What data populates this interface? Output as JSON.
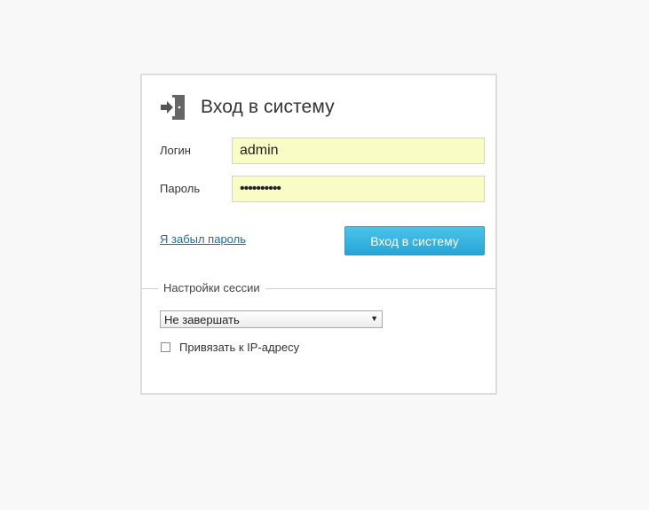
{
  "login": {
    "title": "Вход в систему",
    "icon": "sign-in-icon",
    "username": {
      "label": "Логин",
      "value": "admin"
    },
    "password": {
      "label": "Пароль",
      "value": "••••••••••"
    },
    "forgot_link": "Я забыл пароль",
    "submit_label": "Вход в систему"
  },
  "session": {
    "legend": "Настройки сессии",
    "select": {
      "selected": "Не завершать",
      "arrow": "▼"
    },
    "ip_bind": {
      "label": "Привязать к IP-адресу",
      "checked": false
    }
  },
  "colors": {
    "page_background": "#f8f8f8",
    "autofill_background": "#fafcc5",
    "button_accent": "#26a6d6",
    "link": "#1a6aa0"
  }
}
